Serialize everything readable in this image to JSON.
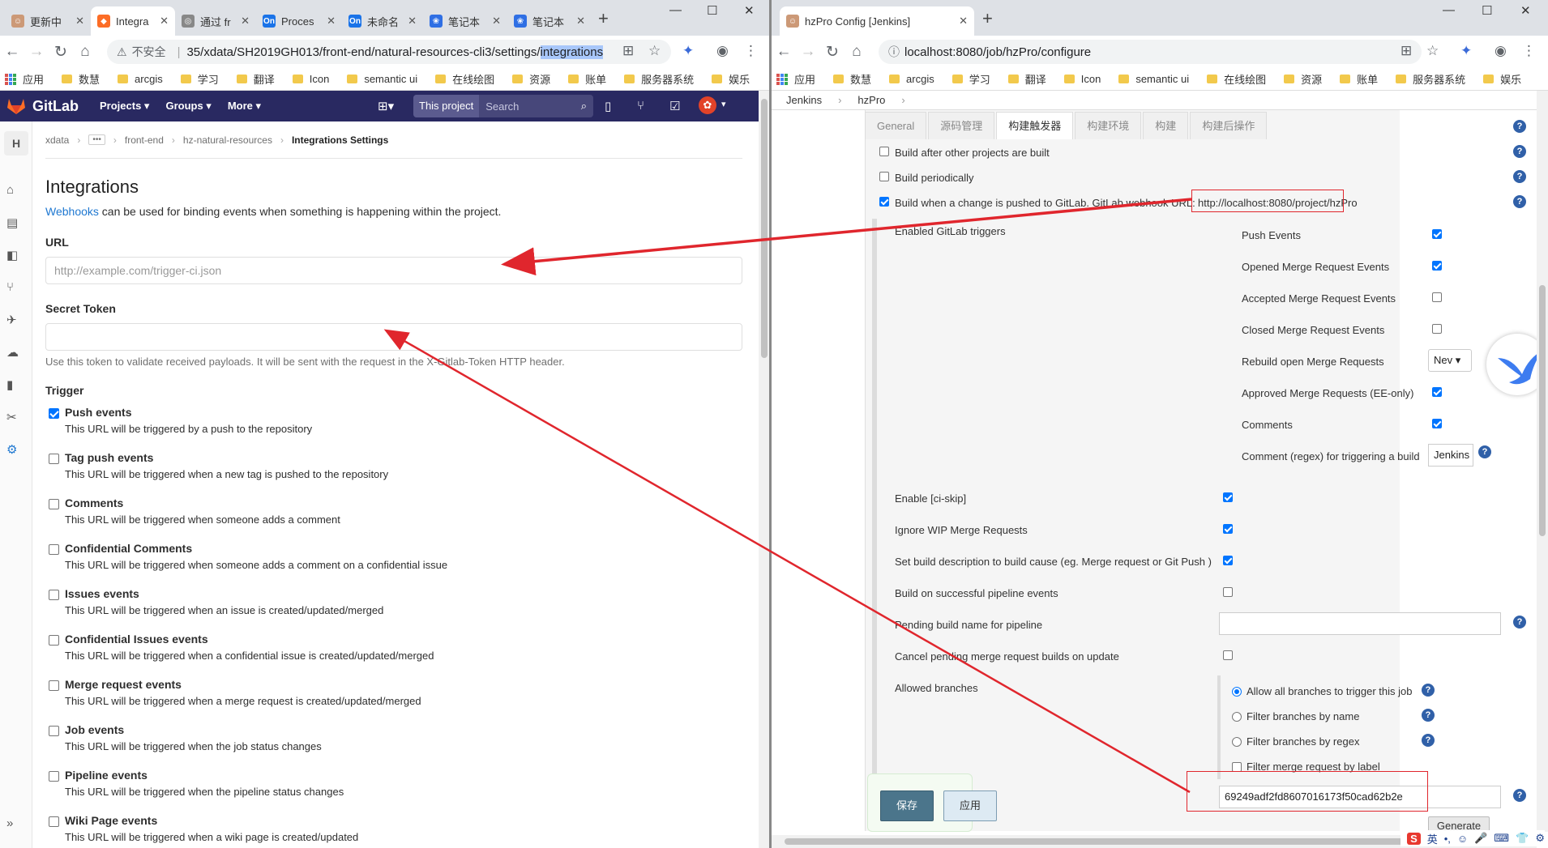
{
  "left": {
    "tabs": [
      {
        "title": "更新中"
      },
      {
        "title": "Integra"
      },
      {
        "title": "通过 fr"
      },
      {
        "title": "Proces"
      },
      {
        "title": "未命名"
      },
      {
        "title": "笔记本"
      },
      {
        "title": "笔记本"
      }
    ],
    "address": {
      "warning": "不安全",
      "path": "35/xdata/SH2019GH013/front-end/natural-resources-cli3/settings/",
      "highlight": "integrations"
    },
    "bookmarks": [
      "应用",
      "数慧",
      "arcgis",
      "学习",
      "翻译",
      "Icon",
      "semantic ui",
      "在线绘图",
      "资源",
      "账单",
      "服务器系统",
      "娱乐"
    ],
    "gitlab": {
      "brand": "GitLab",
      "menu": [
        "Projects ▾",
        "Groups ▾",
        "More ▾"
      ],
      "search_scope": "This project",
      "search_placeholder": "Search",
      "avatar": "H",
      "breadcrumb": [
        "xdata",
        "front-end",
        "hz-natural-resources",
        "Integrations Settings"
      ],
      "title": "Integrations",
      "desc_link": "Webhooks",
      "desc_rest": " can be used for binding events when something is happening within the project.",
      "url_label": "URL",
      "url_placeholder": "http://example.com/trigger-ci.json",
      "token_label": "Secret Token",
      "token_help": "Use this token to validate received payloads. It will be sent with the request in the X-Gitlab-Token HTTP header.",
      "trigger_label": "Trigger",
      "triggers": [
        {
          "label": "Push events",
          "desc": "This URL will be triggered by a push to the repository",
          "checked": true
        },
        {
          "label": "Tag push events",
          "desc": "This URL will be triggered when a new tag is pushed to the repository",
          "checked": false
        },
        {
          "label": "Comments",
          "desc": "This URL will be triggered when someone adds a comment",
          "checked": false
        },
        {
          "label": "Confidential Comments",
          "desc": "This URL will be triggered when someone adds a comment on a confidential issue",
          "checked": false
        },
        {
          "label": "Issues events",
          "desc": "This URL will be triggered when an issue is created/updated/merged",
          "checked": false
        },
        {
          "label": "Confidential Issues events",
          "desc": "This URL will be triggered when a confidential issue is created/updated/merged",
          "checked": false
        },
        {
          "label": "Merge request events",
          "desc": "This URL will be triggered when a merge request is created/updated/merged",
          "checked": false
        },
        {
          "label": "Job events",
          "desc": "This URL will be triggered when the job status changes",
          "checked": false
        },
        {
          "label": "Pipeline events",
          "desc": "This URL will be triggered when the pipeline status changes",
          "checked": false
        },
        {
          "label": "Wiki Page events",
          "desc": "This URL will be triggered when a wiki page is created/updated",
          "checked": false
        }
      ]
    }
  },
  "right": {
    "tab_title": "hzPro Config [Jenkins]",
    "address": "localhost:8080/job/hzPro/configure",
    "bookmarks": [
      "应用",
      "数慧",
      "arcgis",
      "学习",
      "翻译",
      "Icon",
      "semantic ui",
      "在线绘图",
      "资源",
      "账单",
      "服务器系统",
      "娱乐"
    ],
    "breadcrumb": [
      "Jenkins",
      "hzPro"
    ],
    "tabs": [
      "General",
      "源码管理",
      "构建触发器",
      "构建环境",
      "构建",
      "构建后操作"
    ],
    "build_after": "Build after other projects are built",
    "build_periodically": "Build periodically",
    "build_push": "Build when a change is pushed to GitLab. GitLab webhook URL:",
    "webhook_url": "http://localhost:8080/project/hzPro",
    "enabled_triggers": "Enabled GitLab triggers",
    "gitlab_triggers": [
      {
        "label": "Push Events",
        "checked": true
      },
      {
        "label": "Opened Merge Request Events",
        "checked": true
      },
      {
        "label": "Accepted Merge Request Events",
        "checked": false
      },
      {
        "label": "Closed Merge Request Events",
        "checked": false
      },
      {
        "label": "Rebuild open Merge Requests",
        "select": "Nev"
      },
      {
        "label": "Approved Merge Requests (EE-only)",
        "checked": true
      },
      {
        "label": "Comments",
        "checked": true
      }
    ],
    "comment_regex_label": "Comment (regex) for triggering a build",
    "comment_regex_value": "Jenkins",
    "options": [
      {
        "label": "Enable [ci-skip]",
        "checked": true
      },
      {
        "label": "Ignore WIP Merge Requests",
        "checked": true
      },
      {
        "label": "Set build description to build cause (eg. Merge request or Git Push )",
        "checked": true
      },
      {
        "label": "Build on successful pipeline events",
        "checked": false
      }
    ],
    "pending_label": "Pending build name for pipeline",
    "cancel_label": "Cancel pending merge request builds on update",
    "allowed_branches": "Allowed branches",
    "branch_options": [
      {
        "label": "Allow all branches to trigger this job",
        "selected": true
      },
      {
        "label": "Filter branches by name",
        "selected": false
      },
      {
        "label": "Filter branches by regex",
        "selected": false
      }
    ],
    "filter_label": "Filter merge request by label",
    "secret_token": "69249adf2fd8607016173f50cad62b2e",
    "save": "保存",
    "apply": "应用",
    "generate": "Generate",
    "ime": [
      "英",
      "•,",
      "☺",
      "🎤",
      "⌨",
      "👕",
      "⚙"
    ]
  }
}
